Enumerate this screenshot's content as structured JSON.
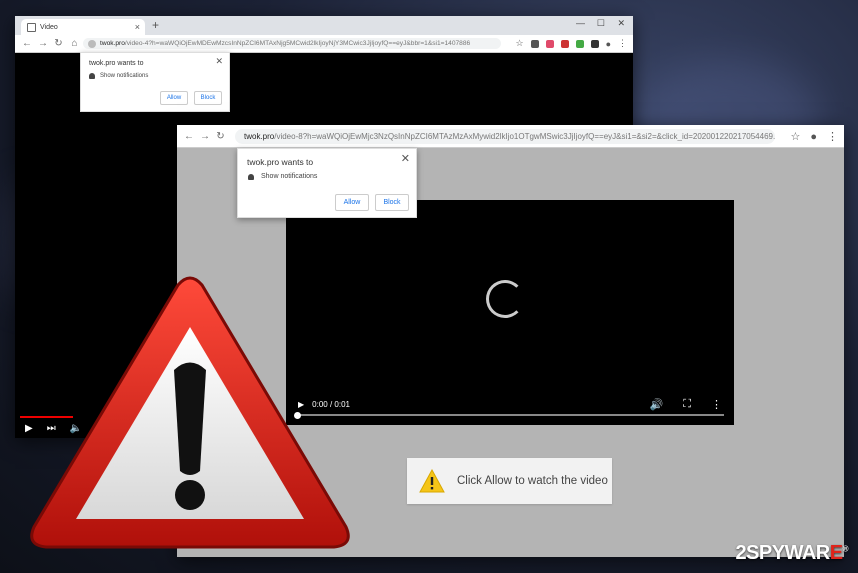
{
  "window1": {
    "tab_title": "Video",
    "url_host": "twok.pro",
    "url_path": "/video-4?h=waWQiOjEwMDEwMzcsInNpZCI6MTAxNjg5MCwid2lkIjoyNjY3MCwic3JjIjoyfQ==eyJ&bbr=1&si1=1407886",
    "popup": {
      "title": "twok.pro wants to",
      "permission": "Show notifications",
      "allow": "Allow",
      "block": "Block"
    }
  },
  "window2": {
    "url_host": "twok.pro",
    "url_path": "/video-8?h=waWQiOjEwMjc3NzQsInNpZCI6MTAzMzAxMywid2lkIjo1OTgwMSwic3JjIjoyfQ==eyJ&si1=&si2=&click_id=202001220217054469...",
    "popup": {
      "title": "twok.pro wants to",
      "permission": "Show notifications",
      "allow": "Allow",
      "block": "Block"
    },
    "player": {
      "time": "0:00 / 0:01",
      "progress": 0
    },
    "cta_text": "Click Allow to watch the video"
  },
  "watermark": {
    "part1": "2SPYWAR",
    "part2": "E",
    "trademark": "®"
  },
  "colors": {
    "warning_red": "#d9160f",
    "warning_yellow": "#f5c518",
    "progress_red": "#e00000"
  }
}
